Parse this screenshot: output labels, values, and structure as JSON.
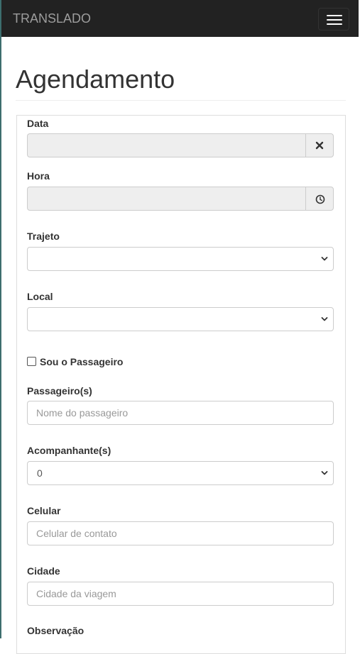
{
  "navbar": {
    "brand": "TRANSLADO"
  },
  "page": {
    "title": "Agendamento"
  },
  "form": {
    "data": {
      "label": "Data",
      "value": ""
    },
    "hora": {
      "label": "Hora",
      "value": ""
    },
    "trajeto": {
      "label": "Trajeto",
      "selected": ""
    },
    "local": {
      "label": "Local",
      "selected": ""
    },
    "sou_passageiro": {
      "label": "Sou o Passageiro",
      "checked": false
    },
    "passageiros": {
      "label": "Passageiro(s)",
      "placeholder": "Nome do passageiro"
    },
    "acompanhantes": {
      "label": "Acompanhante(s)",
      "selected": "0"
    },
    "celular": {
      "label": "Celular",
      "placeholder": "Celular de contato"
    },
    "cidade": {
      "label": "Cidade",
      "placeholder": "Cidade da viagem"
    },
    "observacao": {
      "label": "Observação"
    }
  },
  "icons": {
    "menu": "hamburger-icon",
    "clear": "close-icon",
    "clock": "clock-icon",
    "dropdown": "chevron-down-icon"
  },
  "colors": {
    "navbar_bg": "#222222",
    "brand_text": "#9d9d9d",
    "disabled_input_bg": "#eeeeee",
    "border": "#cccccc"
  }
}
